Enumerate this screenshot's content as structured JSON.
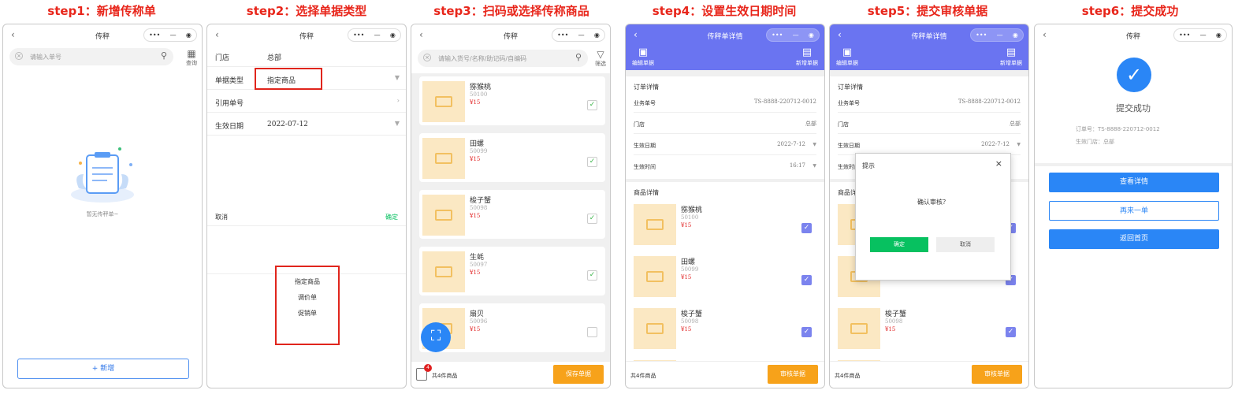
{
  "steps": [
    "step1：新增传称单",
    "step2：选择单据类型",
    "step3：扫码或选择传称商品",
    "step4：设置生效日期时间",
    "step5：提交审核单据",
    "step6：提交成功"
  ],
  "common": {
    "back": "‹",
    "app_title": "传秤",
    "capsule": [
      "•••",
      "—",
      "◉"
    ]
  },
  "s1": {
    "placeholder": "请输入单号",
    "query": "查询",
    "empty": "暂无传秤单~",
    "add": "+ 新增"
  },
  "s2": {
    "rows": [
      {
        "k": "门店",
        "v": "总部"
      },
      {
        "k": "单据类型",
        "v": "指定商品"
      },
      {
        "k": "引用单号",
        "v": ""
      },
      {
        "k": "生效日期",
        "v": "2022-07-12"
      }
    ],
    "cancel": "取消",
    "ok": "确定",
    "options": [
      "指定商品",
      "调价单",
      "促销单"
    ]
  },
  "s3": {
    "placeholder": "请输入货号/名称/助记码/自编码",
    "filter": "筛选",
    "count": "共4件商品",
    "save": "保存单据",
    "badge": "4"
  },
  "products": [
    {
      "name": "猕猴桃",
      "code": "50100",
      "price": "¥15",
      "checked": true
    },
    {
      "name": "田螺",
      "code": "50099",
      "price": "¥15",
      "checked": true
    },
    {
      "name": "梭子蟹",
      "code": "50098",
      "price": "¥15",
      "checked": true
    },
    {
      "name": "生蚝",
      "code": "50097",
      "price": "¥15",
      "checked": true
    },
    {
      "name": "扇贝",
      "code": "50096",
      "price": "¥15",
      "checked": false
    }
  ],
  "s4": {
    "title": "传秤单详情",
    "edit": "编辑单据",
    "new": "新增单据",
    "order_section": "订单详情",
    "rows": [
      {
        "k": "业务单号",
        "v": "TS-8888-220712-0012"
      },
      {
        "k": "门店",
        "v": "总部"
      },
      {
        "k": "生效日期",
        "v": "2022-7-12"
      },
      {
        "k": "生效时间",
        "v": "16:17"
      }
    ],
    "goods_section": "商品详情",
    "count": "共4件商品",
    "audit": "审核单据"
  },
  "s5": {
    "dialog_title": "提示",
    "dialog_msg": "确认审核？",
    "confirm": "确定",
    "cancel": "取消"
  },
  "s6": {
    "success": "提交成功",
    "order": "订单号：TS-8888-220712-0012",
    "store": "生效门店：总部",
    "view": "查看详情",
    "again": "再来一单",
    "home": "返回首页"
  },
  "colors": {
    "accent": "#6a74f1",
    "red": "#e8261b",
    "orange": "#f7a21a",
    "blue_btn": "#2a86f6",
    "green": "#07c160"
  }
}
